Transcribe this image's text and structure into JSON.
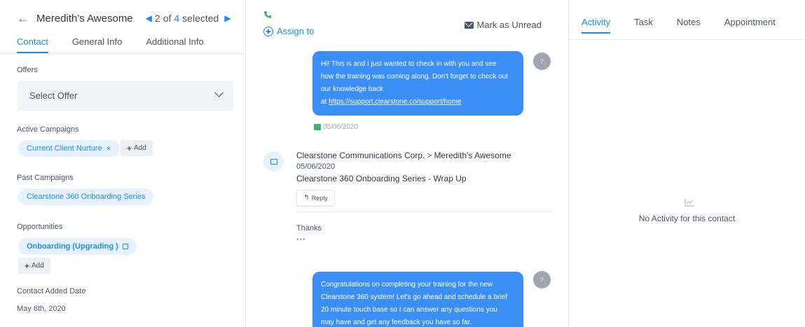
{
  "header": {
    "back_icon": "arrow-left-icon",
    "contact_name": "Meredith's Awesome",
    "current": "2",
    "of_text": "of",
    "total": "4",
    "selected_text": "selected"
  },
  "left_tabs": [
    "Contact",
    "General Info",
    "Additional Info"
  ],
  "offers": {
    "label": "Offers",
    "select_value": "Select Offer"
  },
  "active_campaigns": {
    "label": "Active Campaigns",
    "tag": "Current Client Nurture",
    "add_label": "Add"
  },
  "past_campaigns": {
    "label": "Past Campaigns",
    "tag": "Clearstone 360 Onboarding Series"
  },
  "opportunities": {
    "label": "Opportunities",
    "tag": "Onboarding (Upgrading )",
    "add_label": "Add"
  },
  "contact_added": {
    "label": "Contact Added Date",
    "value": "May 6th, 2020"
  },
  "toolbar": {
    "assign_label": "Assign to",
    "mark_unread_label": "Mark as Unread"
  },
  "messages": {
    "sms1": {
      "line1": "Hi! This is  and I just wanted to check in with you and see",
      "line2": "how the training was coming along. Don't forget to check out",
      "line3": "our knowledge back",
      "line4_prefix": "at",
      "link": "https://support.clearstone.co/support/home",
      "avatar": "?",
      "date": "05/06/2020"
    },
    "email": {
      "from": "Clearstone Communications Corp.",
      "separator": ">",
      "to": "Meredith's Awesome",
      "date": "05/06/2020",
      "subject": "Clearstone 360 Onboarding Series - Wrap Up",
      "reply_label": "Reply",
      "body": "Thanks",
      "ellipsis": "•••"
    },
    "sms2": {
      "line1": "Congratulations on completing your training for the new",
      "line2": "Clearstone 360 system! Let's go ahead and schedule a brief",
      "line3": "20 minute touch base so I can answer any questions you",
      "line4": "may have and get any feedback you have so far.",
      "avatar": "?"
    }
  },
  "right_tabs": [
    "Activity",
    "Task",
    "Notes",
    "Appointment"
  ],
  "activity": {
    "empty_text": "No Activity for this contact"
  },
  "colors": {
    "accent": "#188bf6",
    "bubble": "#3b8ef3",
    "phone_green": "#3cb371"
  }
}
